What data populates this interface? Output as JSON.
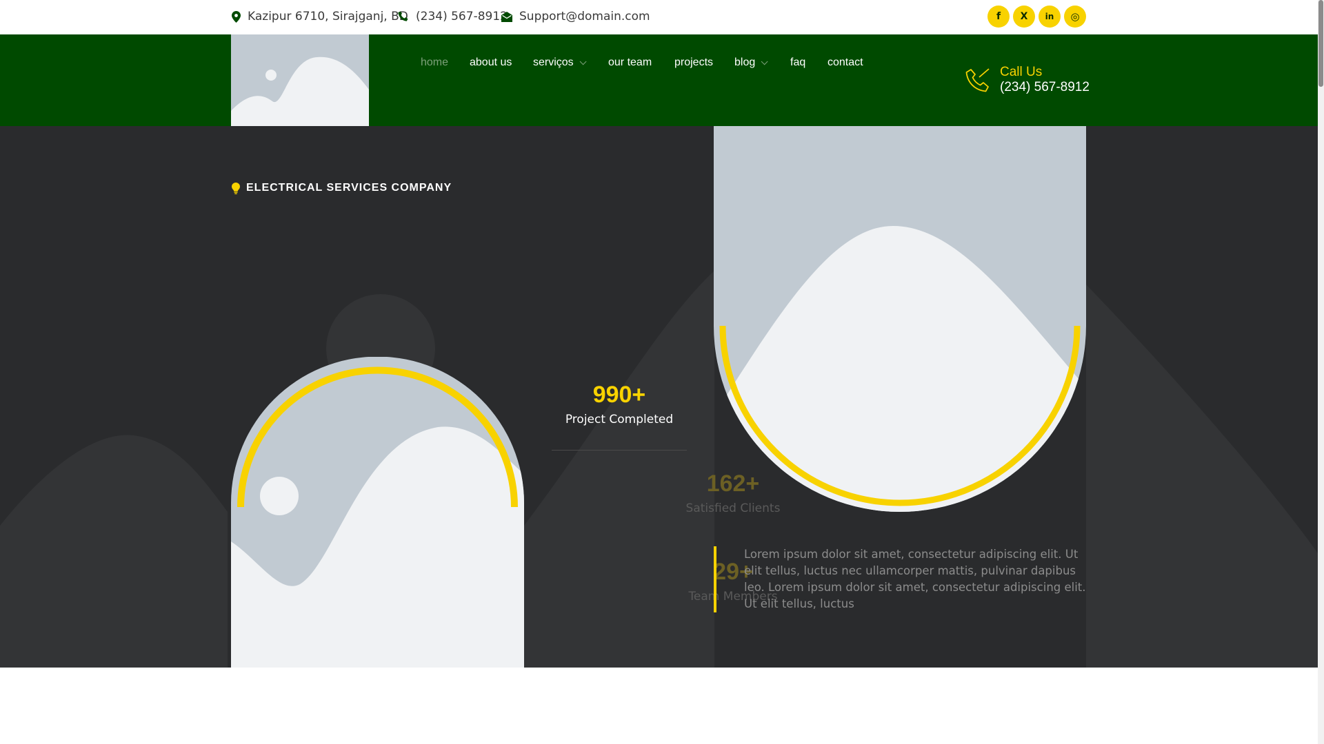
{
  "topbar": {
    "address": "Kazipur 6710, Sirajganj, BD",
    "phone": "(234) 567-8912",
    "email": "Support@domain.com",
    "socials": [
      {
        "name": "facebook",
        "glyph": "f"
      },
      {
        "name": "x",
        "glyph": "X"
      },
      {
        "name": "linkedin",
        "glyph": "in"
      },
      {
        "name": "instagram",
        "glyph": "◎"
      }
    ]
  },
  "nav": {
    "items": [
      {
        "label": "home",
        "active": true,
        "dropdown": false
      },
      {
        "label": "about us",
        "active": false,
        "dropdown": false
      },
      {
        "label": "serviços",
        "active": false,
        "dropdown": true
      },
      {
        "label": "our team",
        "active": false,
        "dropdown": false
      },
      {
        "label": "projects",
        "active": false,
        "dropdown": false
      },
      {
        "label": "blog",
        "active": false,
        "dropdown": true
      },
      {
        "label": "faq",
        "active": false,
        "dropdown": false
      },
      {
        "label": "contact",
        "active": false,
        "dropdown": false
      }
    ]
  },
  "call": {
    "label": "Call Us",
    "number": "(234) 567-8912"
  },
  "hero": {
    "tagline": "ELECTRICAL SERVICES COMPANY",
    "stats": [
      {
        "value": "990+",
        "label": "Project Completed"
      },
      {
        "value": "162+",
        "label": "Satisfied Clients"
      },
      {
        "value": "29+",
        "label": "Team Members"
      }
    ],
    "description": "Lorem ipsum dolor sit amet, consectetur adipiscing elit. Ut elit tellus, luctus nec ullamcorper mattis, pulvinar dapibus leo. Lorem ipsum dolor sit amet, consectetur adipiscing elit. Ut elit tellus, luctus"
  },
  "colors": {
    "accent": "#f8d200",
    "header_green": "#004a00",
    "hero_bg": "#2a2b2d",
    "placeholder_gray": "#c1cad2",
    "placeholder_light": "#f0f2f4"
  }
}
